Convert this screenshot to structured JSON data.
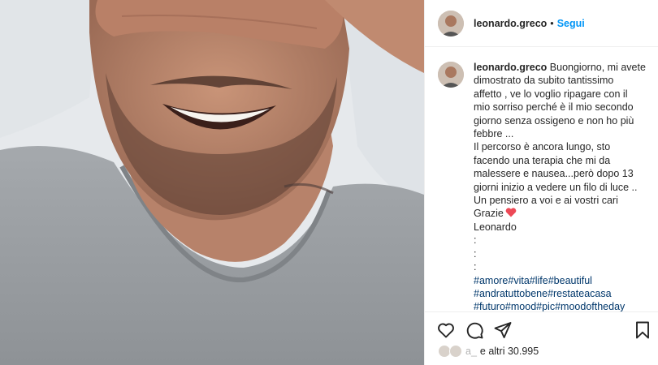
{
  "post": {
    "username": "leonardo.greco",
    "separator": "•",
    "follow_label": "Segui"
  },
  "caption": {
    "username": "leonardo.greco",
    "lines": [
      "Buongiorno, mi avete",
      "dimostrato da subito tantissimo",
      "affetto , ve lo voglio ripagare con il",
      "mio sorriso perché è il mio secondo",
      "giorno senza ossigeno e non ho più",
      "febbre ...",
      "Il percorso è ancora lungo, sto",
      "facendo una terapia che mi da",
      "malessere e nausea...però dopo 13",
      "giorni inizio a vedere un filo di luce ..",
      "Un pensiero a voi e ai vostri cari",
      "Grazie",
      "Leonardo",
      ":",
      ":",
      ":"
    ],
    "hashtag_rows": [
      [
        "#amore",
        "#vita",
        "#life",
        "#beautiful"
      ],
      [
        "#andratuttobene",
        "#restateacasa"
      ],
      [
        "#futuro",
        "#mood",
        "#pic",
        "#moodoftheday"
      ]
    ]
  },
  "likes": {
    "name_partial": "a_",
    "text": "e altri 30.995"
  },
  "colors": {
    "accent": "#0095f6",
    "hashtag": "#00376b",
    "heart": "#ed4956",
    "text": "#262626"
  },
  "icons": {
    "like": "heart-outline-icon",
    "comment": "comment-bubble-icon",
    "share": "paper-plane-icon",
    "save": "bookmark-icon",
    "caption_heart": "red-heart-emoji"
  }
}
